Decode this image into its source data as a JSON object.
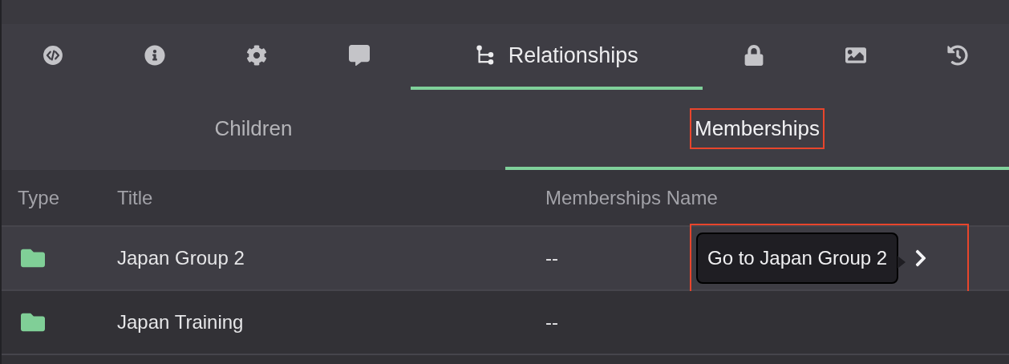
{
  "tabs": [
    {
      "selected": false
    },
    {
      "selected": false
    },
    {
      "selected": false
    },
    {
      "selected": false
    },
    {
      "label": "Relationships",
      "selected": true
    },
    {
      "selected": false
    },
    {
      "selected": false
    },
    {
      "selected": false
    }
  ],
  "subtabs": [
    {
      "label": "Children",
      "selected": false,
      "highlighted": false
    },
    {
      "label": "Memberships",
      "selected": true,
      "highlighted": true
    }
  ],
  "table": {
    "columns": [
      "Type",
      "Title",
      "Memberships Name"
    ],
    "rows": [
      {
        "title": "Japan Group 2",
        "name": "--",
        "hovered": true,
        "tooltip": "Go to Japan Group 2",
        "highlighted": true
      },
      {
        "title": "Japan Training",
        "name": "--",
        "hovered": false,
        "highlighted": false
      }
    ]
  }
}
